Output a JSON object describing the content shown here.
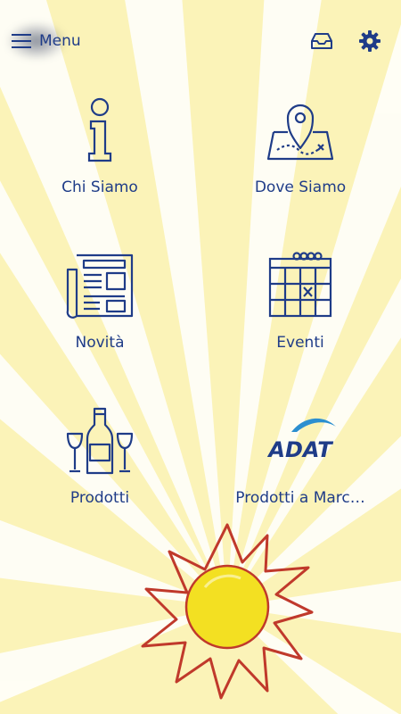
{
  "header": {
    "menu_label": "Menu",
    "inbox_icon": "inbox-icon",
    "settings_icon": "gear-icon"
  },
  "tiles": [
    {
      "label": "Chi Siamo",
      "icon": "info-icon"
    },
    {
      "label": "Dove Siamo",
      "icon": "map-pin-icon"
    },
    {
      "label": "Novità",
      "icon": "newspaper-icon"
    },
    {
      "label": "Eventi",
      "icon": "calendar-icon"
    },
    {
      "label": "Prodotti",
      "icon": "wine-bottle-icon"
    },
    {
      "label": "Prodotti a Marc…",
      "icon": "adat-logo"
    }
  ],
  "logo_text": "ADAT",
  "colors": {
    "background": "#fbf3b8",
    "rays": "#ffffff",
    "accent": "#1f3c88",
    "sun": "#f3e022",
    "sun_outline": "#c0392b"
  }
}
